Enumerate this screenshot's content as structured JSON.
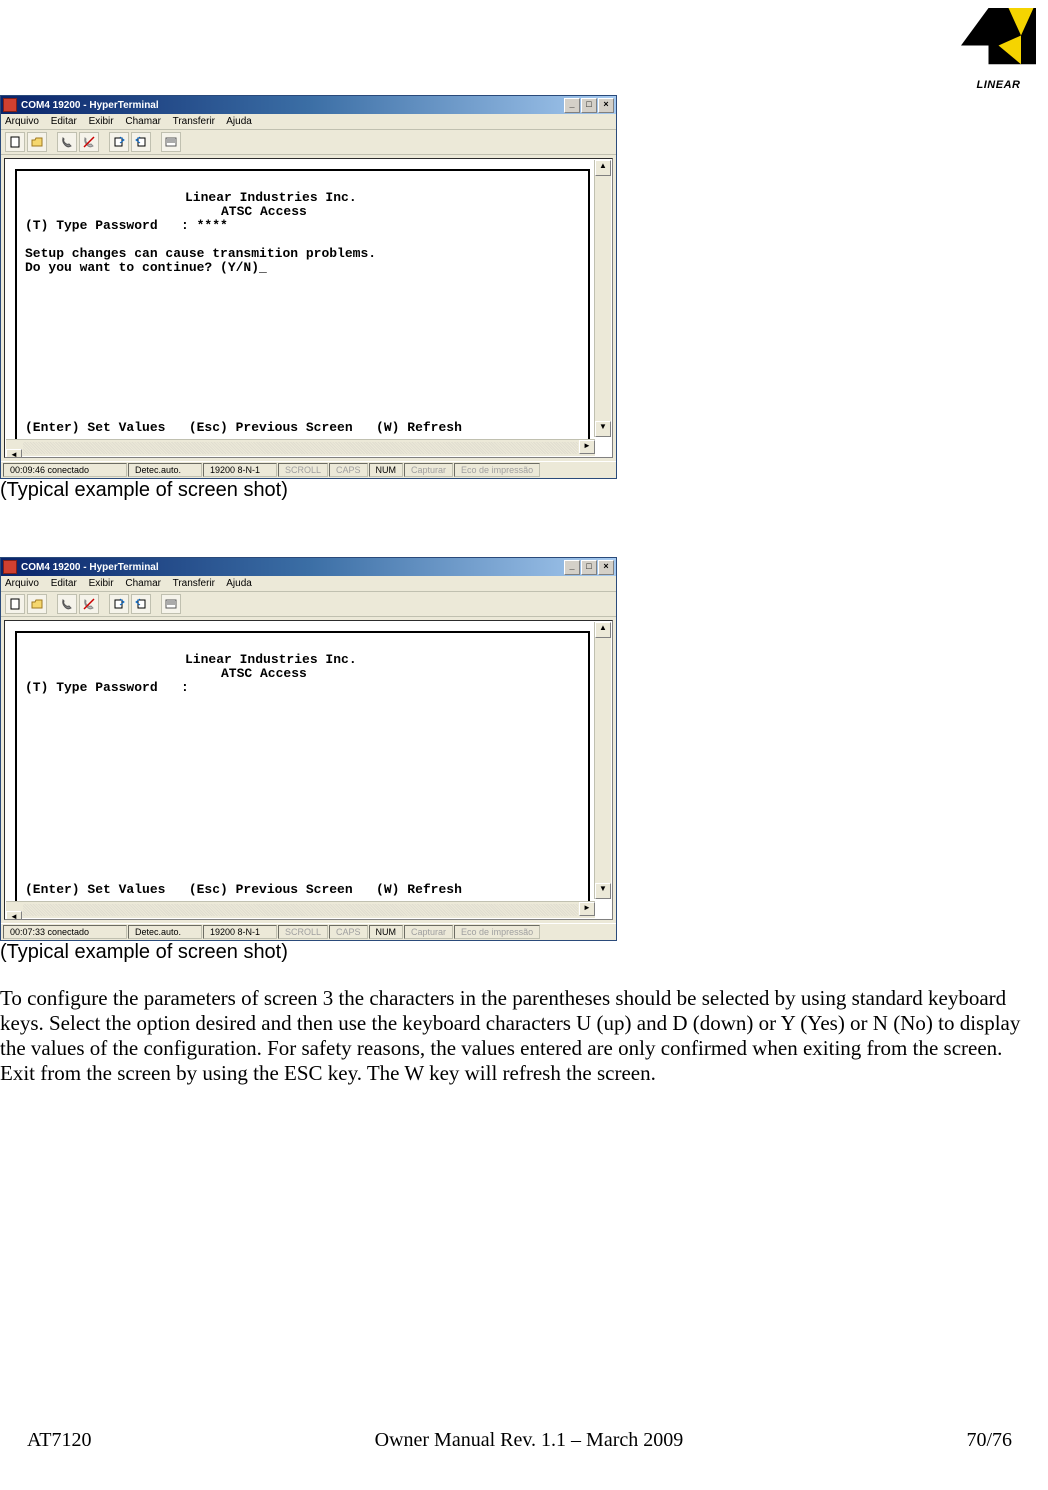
{
  "logo_text": "LINEAR",
  "screenshots": {
    "title": "COM4 19200 - HyperTerminal",
    "menu": [
      "Arquivo",
      "Editar",
      "Exibir",
      "Chamar",
      "Transferir",
      "Ajuda"
    ],
    "caption": "(Typical example of screen shot)",
    "window_buttons": {
      "minimize": "_",
      "maximize": "□",
      "close": "×"
    },
    "status_labels": {
      "scroll": "SCROLL",
      "caps": "CAPS",
      "num": "NUM",
      "capturar": "Capturar",
      "eco": "Eco de impressão"
    }
  },
  "terminal1": {
    "header1": "Linear Industries Inc.",
    "header2": "ATSC Access",
    "line1": "(T) Type Password   : ****",
    "line2": "Setup changes can cause transmition problems.",
    "line3": "Do you want to continue? (Y/N)_",
    "footer": "(Enter) Set Values   (Esc) Previous Screen   (W) Refresh",
    "status_time": "00:09:46 conectado",
    "status_detect": "Detec.auto.",
    "status_baud": "19200 8-N-1"
  },
  "terminal2": {
    "header1": "Linear Industries Inc.",
    "header2": "ATSC Access",
    "line1": "(T) Type Password   :",
    "footer": "(Enter) Set Values   (Esc) Previous Screen   (W) Refresh",
    "status_time": "00:07:33 conectado",
    "status_detect": "Detec.auto.",
    "status_baud": "19200 8-N-1"
  },
  "body_paragraph": "To configure the parameters of screen 3 the characters in the parentheses should be selected by using standard keyboard keys. Select the option desired and then use the keyboard characters U (up) and D (down) or Y (Yes) or N (No) to display the values of the configuration. For safety reasons, the values entered are only confirmed when exiting from the screen. Exit from the screen by using the ESC key. The W key will refresh the screen.",
  "footer": {
    "left": "AT7120",
    "center": "Owner Manual Rev. 1.1 – March 2009",
    "right": "70/76"
  }
}
